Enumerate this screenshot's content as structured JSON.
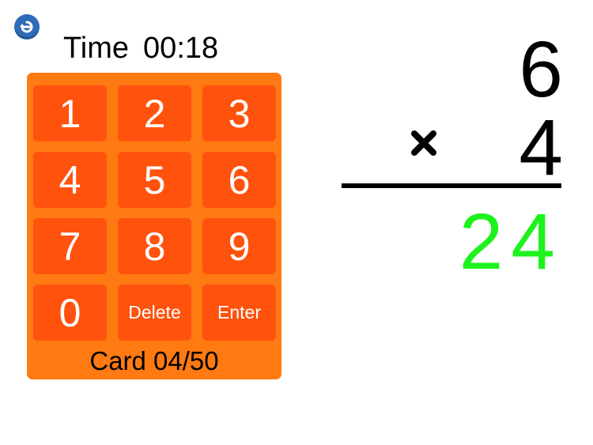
{
  "timer": {
    "label": "Time",
    "value": "00:18"
  },
  "keypad": {
    "keys": [
      "1",
      "2",
      "3",
      "4",
      "5",
      "6",
      "7",
      "8",
      "9",
      "0",
      "Delete",
      "Enter"
    ],
    "card_counter": "Card 04/50"
  },
  "problem": {
    "top_operand": "6",
    "bottom_operand": "4",
    "operator_icon": "times-icon",
    "answer": "24"
  },
  "navigation": {
    "back_icon": "back-arrow-icon"
  },
  "colors": {
    "keypad_background": "#ff7a12",
    "key_background": "#ff520d",
    "answer": "#1df21d",
    "back_button": "#2e6bb8"
  }
}
